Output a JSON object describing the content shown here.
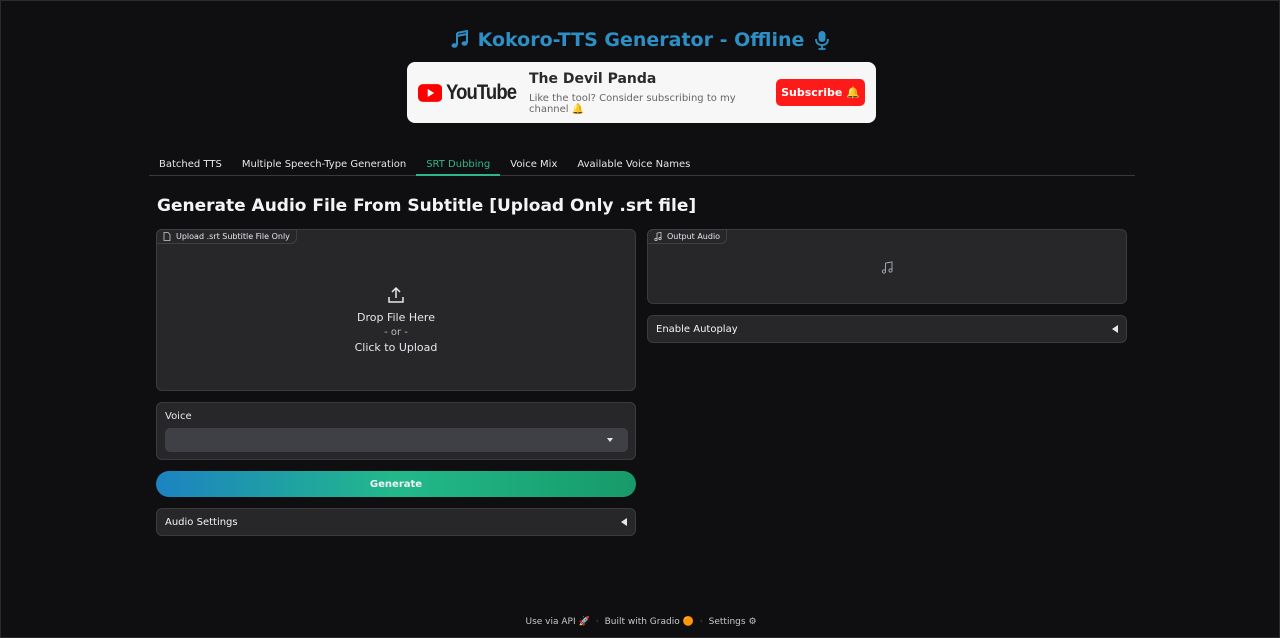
{
  "header": {
    "title": "Kokoro-TTS Generator - Offline",
    "left_icon": "music-note-icon",
    "right_icon": "microphone-icon",
    "accent": "#2d8fc4"
  },
  "youtube_card": {
    "logo_text": "YouTube",
    "channel_name": "The Devil Panda",
    "tagline": "Like the tool? Consider subscribing to my channel 🔔",
    "subscribe_label": "Subscribe 🔔",
    "subscribe_color": "#ff1a1a"
  },
  "tabs": [
    {
      "label": "Batched TTS",
      "active": false
    },
    {
      "label": "Multiple Speech-Type Generation",
      "active": false
    },
    {
      "label": "SRT Dubbing",
      "active": true
    },
    {
      "label": "Voice Mix",
      "active": false
    },
    {
      "label": "Available Voice Names",
      "active": false
    }
  ],
  "main": {
    "heading": "Generate Audio File From Subtitle [Upload Only .srt file]",
    "upload": {
      "label": "Upload .srt Subtitle File Only",
      "drop_text": "Drop File Here",
      "or_text": "- or -",
      "click_text": "Click to Upload"
    },
    "voice": {
      "label": "Voice",
      "selected": ""
    },
    "generate_label": "Generate",
    "audio_settings_label": "Audio Settings",
    "output_audio_label": "Output Audio",
    "enable_autoplay_label": "Enable Autoplay"
  },
  "footer": {
    "api_label": "Use via API",
    "gradio_label": "Built with Gradio",
    "settings_label": "Settings",
    "separator": "·"
  }
}
